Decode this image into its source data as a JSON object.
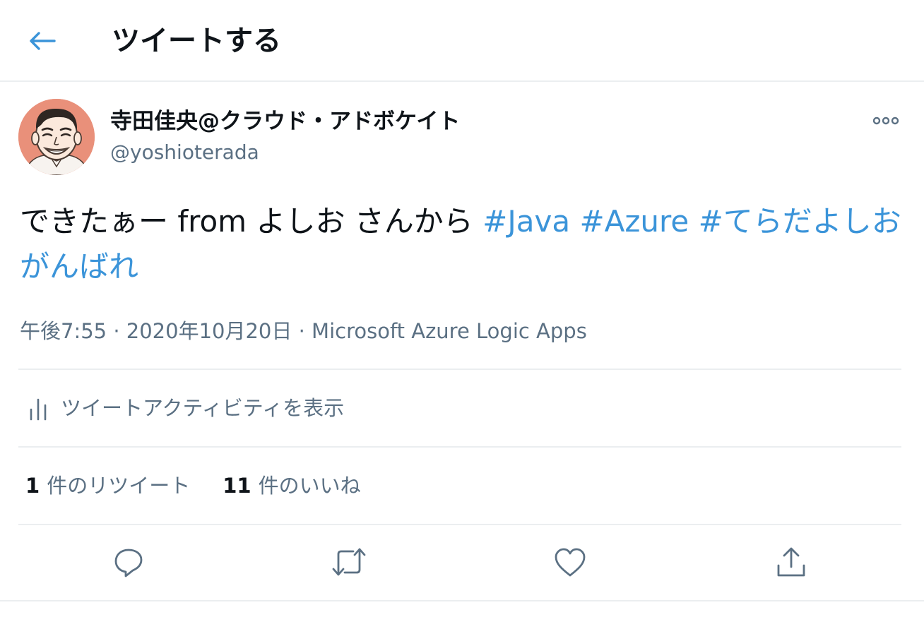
{
  "header": {
    "title": "ツイートする",
    "back_icon": "arrow-left-icon",
    "accent_color": "#3b94d9"
  },
  "tweet": {
    "author": {
      "display_name": "寺田佳央@クラウド・アドボケイト",
      "handle": "@yoshioterada"
    },
    "more_icon": "more-horizontal-icon",
    "text_plain": "できたぁー from よしお さんから ",
    "hashtags": [
      "#Java",
      "#Azure",
      "#てらだよしおがんばれ"
    ],
    "time": "午後7:55",
    "separator": "·",
    "date": "2020年10月20日",
    "source": "Microsoft Azure Logic Apps"
  },
  "activity": {
    "icon": "bar-chart-icon",
    "label": "ツイートアクティビティを表示"
  },
  "stats": {
    "retweets_count": "1",
    "retweets_label": "件のリツイート",
    "likes_count": "11",
    "likes_label": "件のいいね"
  },
  "actions": {
    "reply_icon": "reply-icon",
    "retweet_icon": "retweet-icon",
    "like_icon": "heart-icon",
    "share_icon": "share-icon"
  },
  "colors": {
    "link": "#3b94d9",
    "secondary_text": "#5b7083",
    "divider": "#ebeef0"
  }
}
